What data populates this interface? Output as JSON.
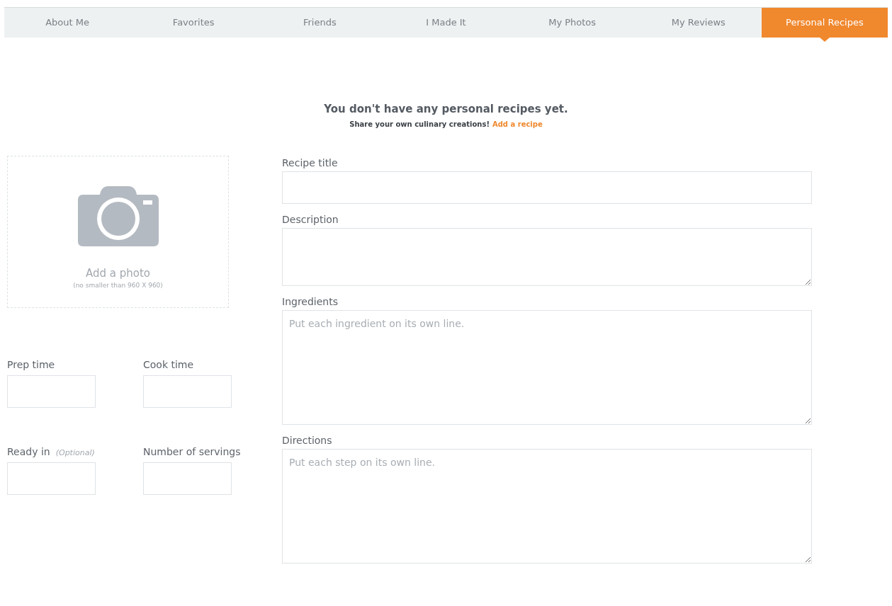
{
  "tabs": [
    {
      "label": "About Me",
      "selected": false
    },
    {
      "label": "Favorites",
      "selected": false
    },
    {
      "label": "Friends",
      "selected": false
    },
    {
      "label": "I Made It",
      "selected": false
    },
    {
      "label": "My Photos",
      "selected": false
    },
    {
      "label": "My Reviews",
      "selected": false
    },
    {
      "label": "Personal Recipes",
      "selected": true
    }
  ],
  "empty_state": {
    "heading": "You don't have any personal recipes yet.",
    "text": "Share your own culinary creations!",
    "link": "Add a recipe"
  },
  "photo": {
    "label": "Add a photo",
    "hint": "(no smaller than 960 X 960)"
  },
  "small_fields": [
    {
      "label": "Prep time"
    },
    {
      "label": "Cook time"
    },
    {
      "label": "Ready in",
      "note": "(Optional)"
    },
    {
      "label": "Number of servings"
    }
  ],
  "fields": [
    {
      "label": "Recipe title",
      "kind": "input"
    },
    {
      "label": "Description",
      "kind": "textarea"
    },
    {
      "label": "Ingredients",
      "kind": "textarea",
      "placeholder": "Put each ingredient on its own line."
    },
    {
      "label": "Directions",
      "kind": "textarea",
      "placeholder": "Put each step on its own line."
    }
  ]
}
